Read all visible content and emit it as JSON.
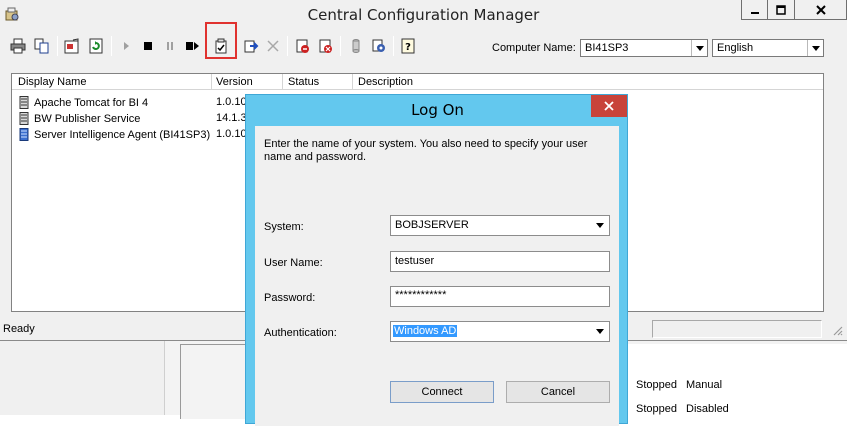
{
  "main_window": {
    "title": "Central Configuration Manager"
  },
  "toolbar": {
    "computer_name_label": "Computer Name:",
    "computer_name_value": "BI41SP3",
    "language_value": "English"
  },
  "service_list": {
    "columns": [
      "Display Name",
      "Version",
      "Status",
      "Description"
    ],
    "rows": [
      {
        "name": "Apache Tomcat for BI 4",
        "version": "1.0.10"
      },
      {
        "name": "BW Publisher Service",
        "version": "14.1.3"
      },
      {
        "name": "Server Intelligence Agent (BI41SP3)",
        "version": "1.0.10"
      }
    ]
  },
  "statusbar": {
    "text": "Ready"
  },
  "background_window": {
    "rows": [
      {
        "status": "Stopped",
        "startup": "Manual"
      },
      {
        "status": "Stopped",
        "startup": "Disabled"
      }
    ]
  },
  "logon_dialog": {
    "title": "Log On",
    "description": "Enter the name of your system. You also need to specify your user name and password.",
    "system_label": "System:",
    "system_value": "BOBJSERVER",
    "username_label": "User Name:",
    "username_value": "testuser",
    "password_label": "Password:",
    "password_value": "************",
    "authentication_label": "Authentication:",
    "authentication_value": "Windows AD",
    "connect_label": "Connect",
    "cancel_label": "Cancel"
  },
  "colors": {
    "dialog_frame": "#63c8ee",
    "close_button": "#c8433a",
    "highlight_box": "#e0322f",
    "selection": "#3399ff"
  }
}
